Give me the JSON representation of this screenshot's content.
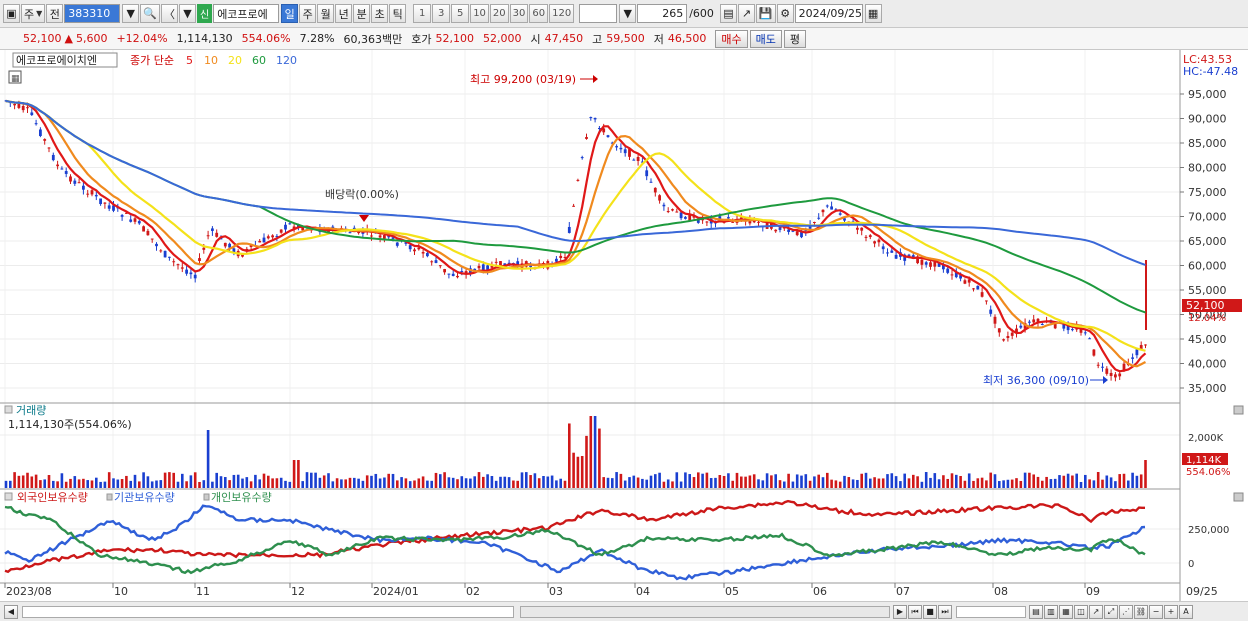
{
  "toolbar": {
    "market": "주",
    "prev": "전",
    "code": "383310",
    "name_badge": "신",
    "name": "에코프로에",
    "periods": [
      "일",
      "주",
      "월",
      "년",
      "분",
      "초",
      "틱"
    ],
    "selected_period": "일",
    "nums": [
      "1",
      "3",
      "5",
      "10",
      "20",
      "30",
      "60",
      "120"
    ],
    "count": "265",
    "count_total": "/600",
    "date": "2024/09/25"
  },
  "quote": {
    "price": "52,100",
    "change": "5,600",
    "change_pct": "+12.04%",
    "volume": "1,114,130",
    "vol_ratio": "554.06%",
    "turnover": "7.28%",
    "amount": "60,363백만",
    "bid_label": "호가",
    "bid1": "52,100",
    "bid2": "52,000",
    "open_label": "시",
    "open": "47,450",
    "high_label": "고",
    "high": "59,500",
    "low_label": "저",
    "low": "46,500",
    "buy": "매수",
    "sell": "매도",
    "eval": "평"
  },
  "price_panel": {
    "stock_label": "에코프로에이치엔",
    "legend_prefix": "종가 단순",
    "ma": [
      {
        "period": "5",
        "color": "#e01818"
      },
      {
        "period": "10",
        "color": "#f08a1e"
      },
      {
        "period": "20",
        "color": "#f4e21a"
      },
      {
        "period": "60",
        "color": "#1e9a3e"
      },
      {
        "period": "120",
        "color": "#3a68d8"
      }
    ],
    "lc": "LC:43.53",
    "hc": "HC:-47.48",
    "high_note": "최고 99,200 (03/19)",
    "low_note": "최저 36,300 (09/10)",
    "div_note": "배당락(0.00%)",
    "price_tag": "52,100",
    "pct_tag": "12.04%",
    "yticks": [
      "95,000",
      "90,000",
      "85,000",
      "80,000",
      "75,000",
      "70,000",
      "65,000",
      "60,000",
      "55,000",
      "50,000",
      "45,000",
      "40,000",
      "35,000"
    ]
  },
  "volume_panel": {
    "title": "거래량",
    "value": "1,114,130주(554.06%)",
    "ytick": "2,000K",
    "tag": "1,114K",
    "tag_pct": "554.06%"
  },
  "holdings_panel": {
    "series": [
      {
        "name": "외국인보유수량",
        "color": "#cc1818"
      },
      {
        "name": "기관보유수량",
        "color": "#2f5fd8"
      },
      {
        "name": "개인보유수량",
        "color": "#2e8f4e"
      }
    ],
    "yticks": [
      "250,000",
      "0"
    ]
  },
  "xaxis": {
    "labels": [
      "2023/08",
      "10",
      "11",
      "12",
      "2024/01",
      "02",
      "03",
      "04",
      "05",
      "06",
      "07",
      "08",
      "09"
    ],
    "right_label": "09/25"
  },
  "colors": {
    "up": "#d01818",
    "down": "#1a3fd0",
    "grid": "#dcdcdc"
  }
}
